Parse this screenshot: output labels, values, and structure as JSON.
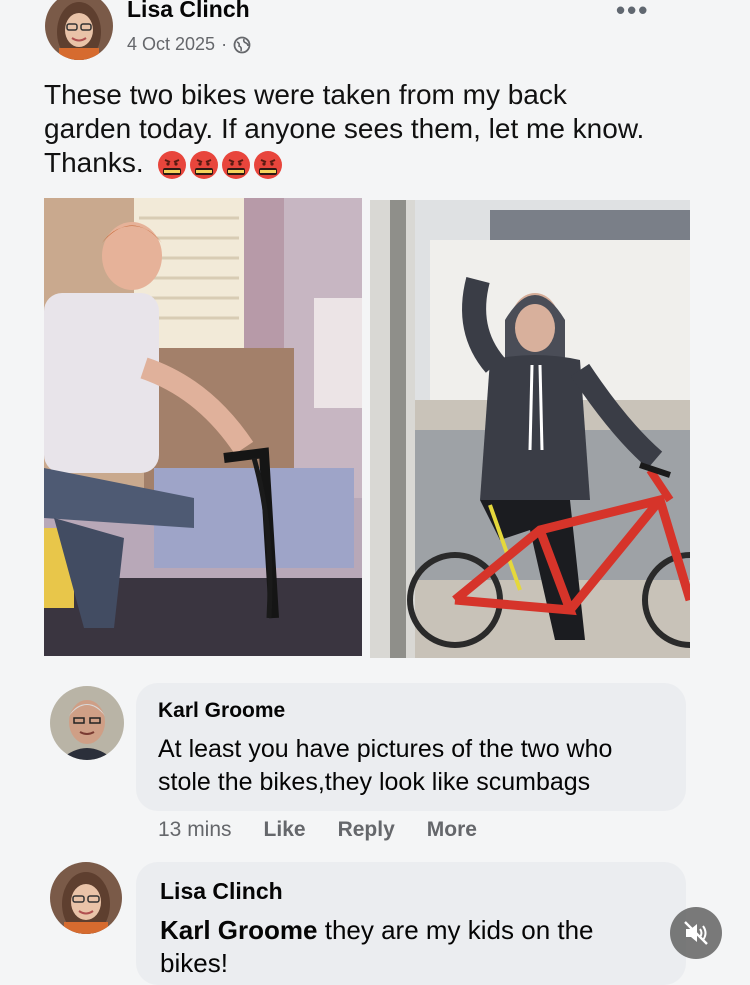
{
  "post": {
    "author": "Lisa Clinch",
    "date": "4 Oct 2025",
    "separator": "·",
    "privacy_icon": "globe-icon",
    "more_icon": "more-dots-icon",
    "text_line1": "These two bikes were taken from my back",
    "text_line2": "garden today. If anyone sees them, let me know.",
    "text_line3": "Thanks.",
    "emoji_icon": "angry-swearing-face-emoji",
    "emoji_count": 4
  },
  "comments": [
    {
      "author": "Karl Groome",
      "text_line1": "At least you have pictures of the two who",
      "text_line2": "stole the bikes,they look like scumbags",
      "time": "13 mins",
      "like_label": "Like",
      "reply_label": "Reply",
      "more_label": "More"
    },
    {
      "author": "Lisa Clinch",
      "mention": "Karl Groome",
      "text_line1": " they are my kids on the",
      "text_line2": "bikes!"
    }
  ],
  "video_control": {
    "icon": "speaker-muted-icon"
  },
  "colors": {
    "meta_gray": "#65676b",
    "bubble_bg": "#ebedf0",
    "bike_red": "#d6342a"
  }
}
